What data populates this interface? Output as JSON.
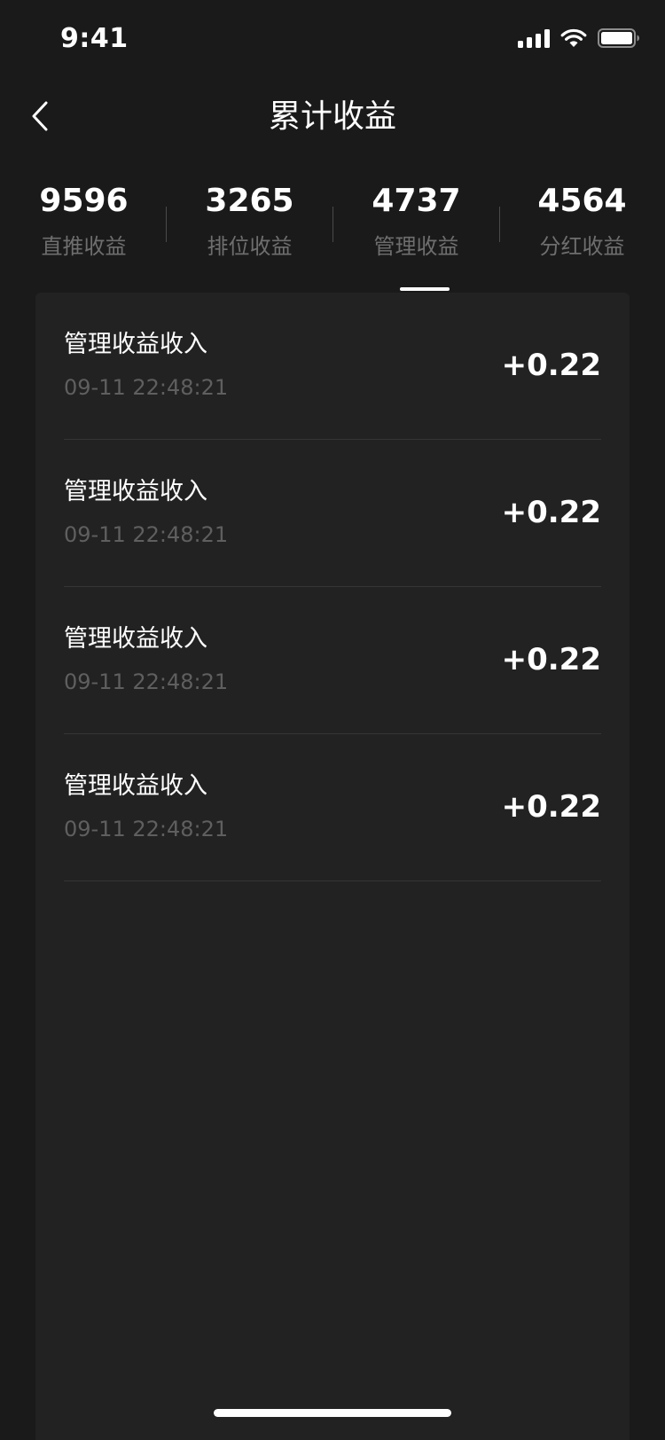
{
  "status_bar": {
    "time": "9:41",
    "icons": [
      "signal-icon",
      "wifi-icon",
      "battery-icon"
    ]
  },
  "nav": {
    "title": "累计收益",
    "back_icon": "chevron-left-icon"
  },
  "stats": [
    {
      "value": "9596",
      "label": "直推收益"
    },
    {
      "value": "3265",
      "label": "排位收益"
    },
    {
      "value": "4737",
      "label": "管理收益"
    },
    {
      "value": "4564",
      "label": "分红收益"
    }
  ],
  "active_tab": "管理收益",
  "records": [
    {
      "title": "管理收益收入",
      "time": "09-11 22:48:21",
      "amount": "+0.22"
    },
    {
      "title": "管理收益收入",
      "time": "09-11 22:48:21",
      "amount": "+0.22"
    },
    {
      "title": "管理收益收入",
      "time": "09-11 22:48:21",
      "amount": "+0.22"
    },
    {
      "title": "管理收益收入",
      "time": "09-11 22:48:21",
      "amount": "+0.22"
    }
  ],
  "colors": {
    "background": "#1a1a1a",
    "card": "#222222",
    "text_primary": "#ffffff",
    "text_secondary": "#6e6e6e",
    "divider": "#353535"
  }
}
